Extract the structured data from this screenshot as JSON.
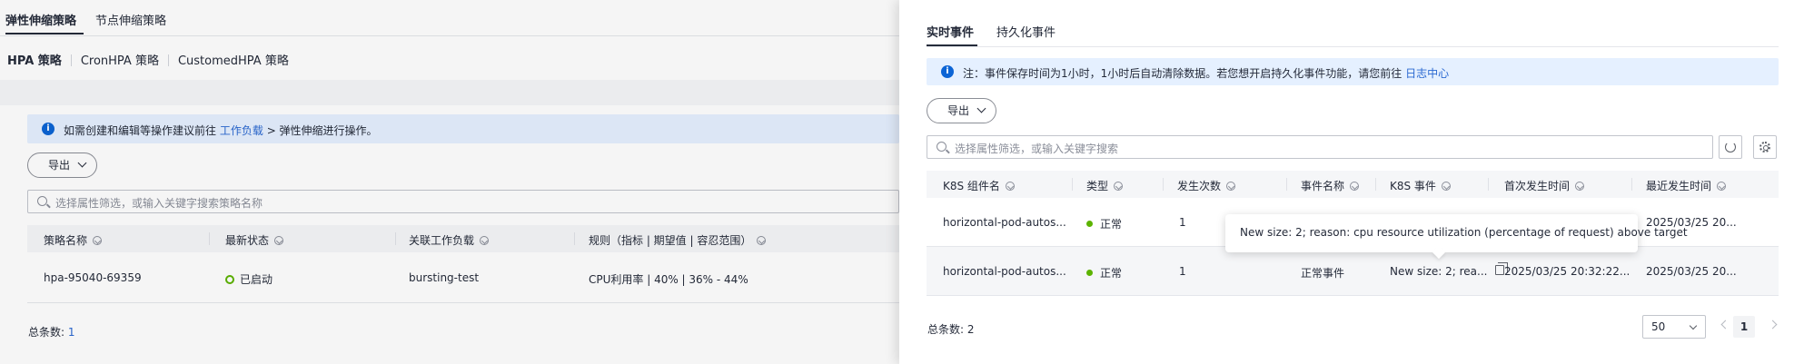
{
  "left": {
    "tabs": [
      "弹性伸缩策略",
      "节点伸缩策略"
    ],
    "subtabs": [
      "HPA 策略",
      "CronHPA 策略",
      "CustomedHPA 策略"
    ],
    "info": {
      "icon": "info-icon",
      "prefix": "如需创建和编辑等操作建议前往",
      "link": "工作负载",
      "suffix": "> 弹性伸缩进行操作。"
    },
    "export_label": "导出",
    "search_placeholder": "选择属性筛选，或输入关键字搜索策略名称",
    "columns": [
      "策略名称",
      "最新状态",
      "关联工作负载",
      "规则（指标 | 期望值 | 容忍范围）"
    ],
    "rows": [
      {
        "name": "hpa-95040-69359",
        "status": "已启动",
        "workload": "bursting-test",
        "rule": "CPU利用率 | 40% | 36% - 44%"
      }
    ],
    "total_label": "总条数:",
    "total_value": "1"
  },
  "drawer": {
    "tabs": [
      "实时事件",
      "持久化事件"
    ],
    "notice": {
      "prefix": "注：事件保存时间为1小时，1小时后自动清除数据。若您想开启持久化事件功能，请您前往",
      "link": "日志中心"
    },
    "export_label": "导出",
    "search_placeholder": "选择属性筛选，或输入关键字搜索",
    "columns": [
      "K8S 组件名",
      "类型",
      "发生次数",
      "事件名称",
      "K8S 事件",
      "首次发生时间",
      "最近发生时间"
    ],
    "rows": [
      {
        "component": "horizontal-pod-autos...",
        "type": "正常",
        "count": "1",
        "event_name": "",
        "k8s_event": "",
        "first_time": "",
        "last_time": "2025/03/25 20..."
      },
      {
        "component": "horizontal-pod-autos...",
        "type": "正常",
        "count": "1",
        "event_name": "正常事件",
        "k8s_event": "New size: 2; rea...",
        "first_time": "2025/03/25 20:32:22...",
        "last_time": "2025/03/25 20..."
      }
    ],
    "tooltip": "New size: 2; reason: cpu resource utilization (percentage of request) above target",
    "total_label": "总条数:",
    "total_value": "2",
    "page_size": "50",
    "current_page": "1"
  },
  "colors": {
    "accent": "#2a68d1",
    "info_bg": "#e5f0ff",
    "status_green": "#5cb300"
  }
}
